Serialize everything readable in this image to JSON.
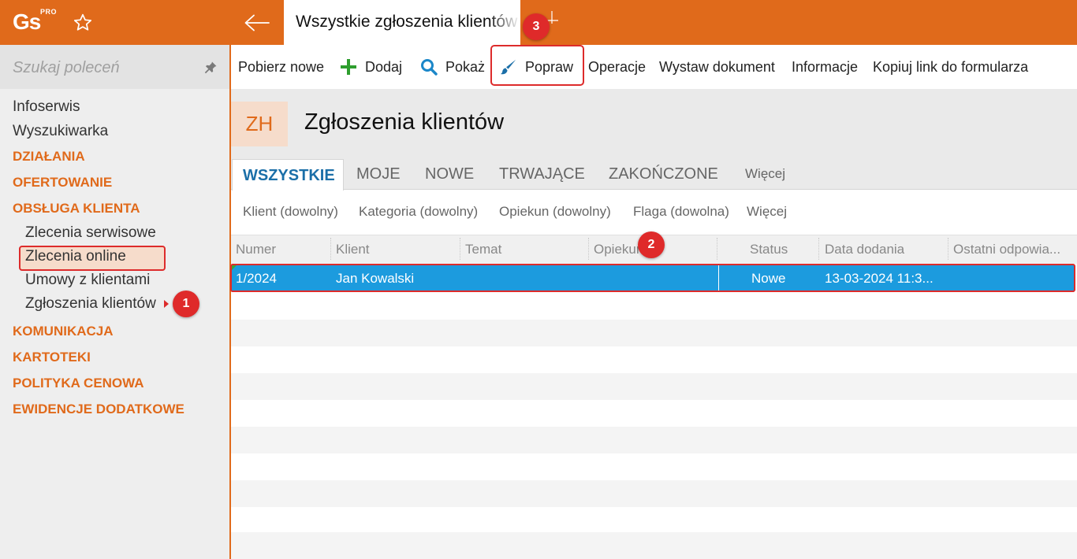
{
  "app": {
    "logo_text": "Gs",
    "logo_badge": "PRO",
    "active_tab_title": "Wszystkie zgłoszenia klientów"
  },
  "sidebar": {
    "search_placeholder": "Szukaj poleceń",
    "items": [
      {
        "label": "Infoserwis",
        "kind": "item"
      },
      {
        "label": "Wyszukiwarka",
        "kind": "item"
      },
      {
        "label": "DZIAŁANIA",
        "kind": "section"
      },
      {
        "label": "OFERTOWANIE",
        "kind": "section"
      },
      {
        "label": "OBSŁUGA KLIENTA",
        "kind": "section"
      },
      {
        "label": "Zlecenia serwisowe",
        "kind": "sub"
      },
      {
        "label": "Zlecenia online",
        "kind": "sub"
      },
      {
        "label": "Umowy z klientami",
        "kind": "sub"
      },
      {
        "label": "Zgłoszenia klientów",
        "kind": "sub",
        "selected": true
      },
      {
        "label": "KOMUNIKACJA",
        "kind": "section"
      },
      {
        "label": "KARTOTEKI",
        "kind": "section"
      },
      {
        "label": "POLITYKA CENOWA",
        "kind": "section"
      },
      {
        "label": "EWIDENCJE DODATKOWE",
        "kind": "section"
      }
    ]
  },
  "toolbar": {
    "fetch_new": "Pobierz nowe",
    "add": "Dodaj",
    "show": "Pokaż",
    "edit": "Popraw",
    "operations": "Operacje",
    "issue_document": "Wystaw dokument",
    "information": "Informacje",
    "copy_link": "Kopiuj link do formularza"
  },
  "page": {
    "badge": "ZH",
    "title": "Zgłoszenia klientów"
  },
  "tabs": [
    {
      "label": "WSZYSTKIE",
      "selected": true
    },
    {
      "label": "MOJE"
    },
    {
      "label": "NOWE"
    },
    {
      "label": "TRWAJĄCE"
    },
    {
      "label": "ZAKOŃCZONE"
    },
    {
      "label": "Więcej"
    }
  ],
  "filters": [
    "Klient (dowolny)",
    "Kategoria (dowolny)",
    "Opiekun (dowolny)",
    "Flaga (dowolna)",
    "Więcej"
  ],
  "table": {
    "columns": [
      "Numer",
      "Klient",
      "Temat",
      "Opiekun",
      "Status",
      "Data dodania",
      "Ostatni odpowia..."
    ],
    "rows": [
      {
        "numer": "1/2024",
        "klient": "Jan Kowalski",
        "temat": "",
        "opiekun": "",
        "status": "Nowe",
        "data_dodania": "13-03-2024 11:3...",
        "ostatni": ""
      }
    ]
  },
  "callouts": [
    "1",
    "2",
    "3"
  ],
  "colors": {
    "brand_orange": "#e06a1b",
    "selected_row": "#1c9bde",
    "tab_active_text": "#1b6fa8",
    "callout_red": "#df2a2a"
  },
  "icons": {
    "favorites": "star-icon",
    "back": "arrow-left-icon",
    "pin": "pin-icon",
    "add": "plus-icon",
    "show": "magnifier-icon",
    "edit": "brush-icon"
  }
}
